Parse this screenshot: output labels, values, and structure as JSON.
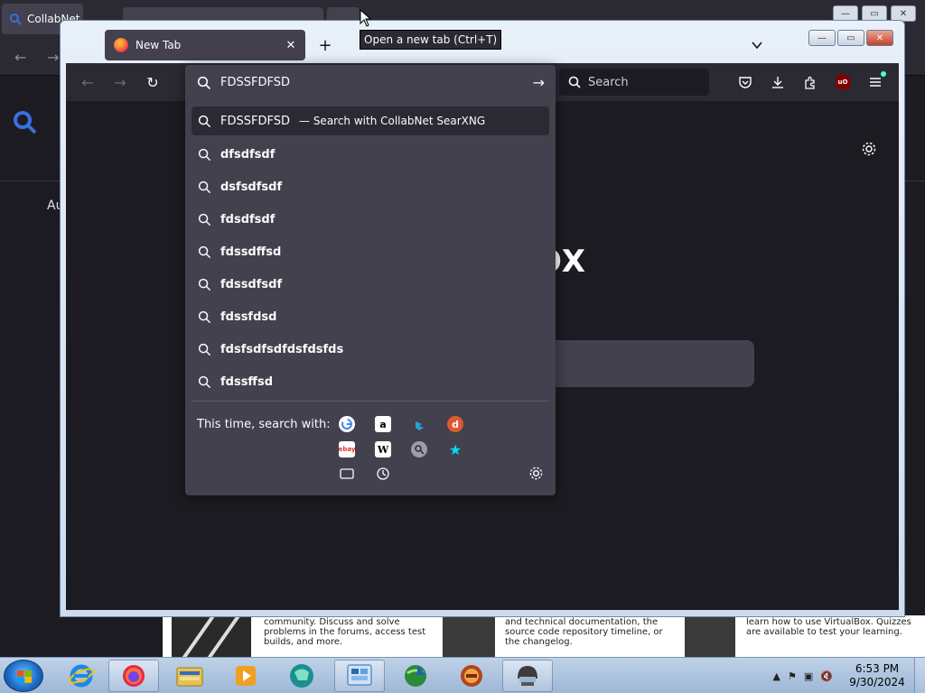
{
  "background_window": {
    "tab_title": "CollabNet",
    "sidebar_text": "Au",
    "bottom_texts": [
      "community. Discuss and solve problems in the forums, access test builds, and more.",
      "and technical documentation, the source code repository timeline, or the changelog.",
      "learn how to use VirtualBox. Quizzes are available to test your learning."
    ]
  },
  "browser": {
    "tab": {
      "title": "New Tab",
      "close_glyph": "✕"
    },
    "new_tab_glyph": "+",
    "tooltip": "Open a new tab (Ctrl+T)",
    "toolbar": {
      "back_glyph": "←",
      "forward_glyph": "→",
      "reload_glyph": "↻",
      "search_placeholder": "Search",
      "ublock_label": "uO"
    },
    "urlbar": {
      "value": "FDSSFDFSD",
      "go_glyph": "→"
    },
    "suggestions": [
      {
        "term": "FDSSFDFSD",
        "hint": "— Search with CollabNet SearXNG",
        "selected": true
      },
      {
        "term": "dfsdfsdf"
      },
      {
        "term": "dsfsdfsdf"
      },
      {
        "term": "fdsdfsdf"
      },
      {
        "term": "fdssdffsd"
      },
      {
        "term": "fdssdfsdf"
      },
      {
        "term": "fdssfdsd"
      },
      {
        "term": "fdsfsdfsdfdsfdsfds"
      },
      {
        "term": "fdssffsd"
      }
    ],
    "one_off": {
      "label": "This time, search with:",
      "engines": [
        "google-icon",
        "amazon-icon",
        "bing-icon",
        "duckduckgo-icon",
        "ebay-icon",
        "wikipedia-icon",
        "searxng-icon",
        "bookmarks-icon",
        "tabs-icon",
        "history-icon"
      ]
    },
    "page": {
      "brand_partial": "OX"
    }
  },
  "taskbar": {
    "clock_time": "6:53 PM",
    "clock_date": "9/30/2024"
  },
  "colors": {
    "toolbar": "#2b2a33",
    "panel": "#42414d",
    "content": "#1c1b22",
    "accent_searxng": "#2f6fe0"
  }
}
